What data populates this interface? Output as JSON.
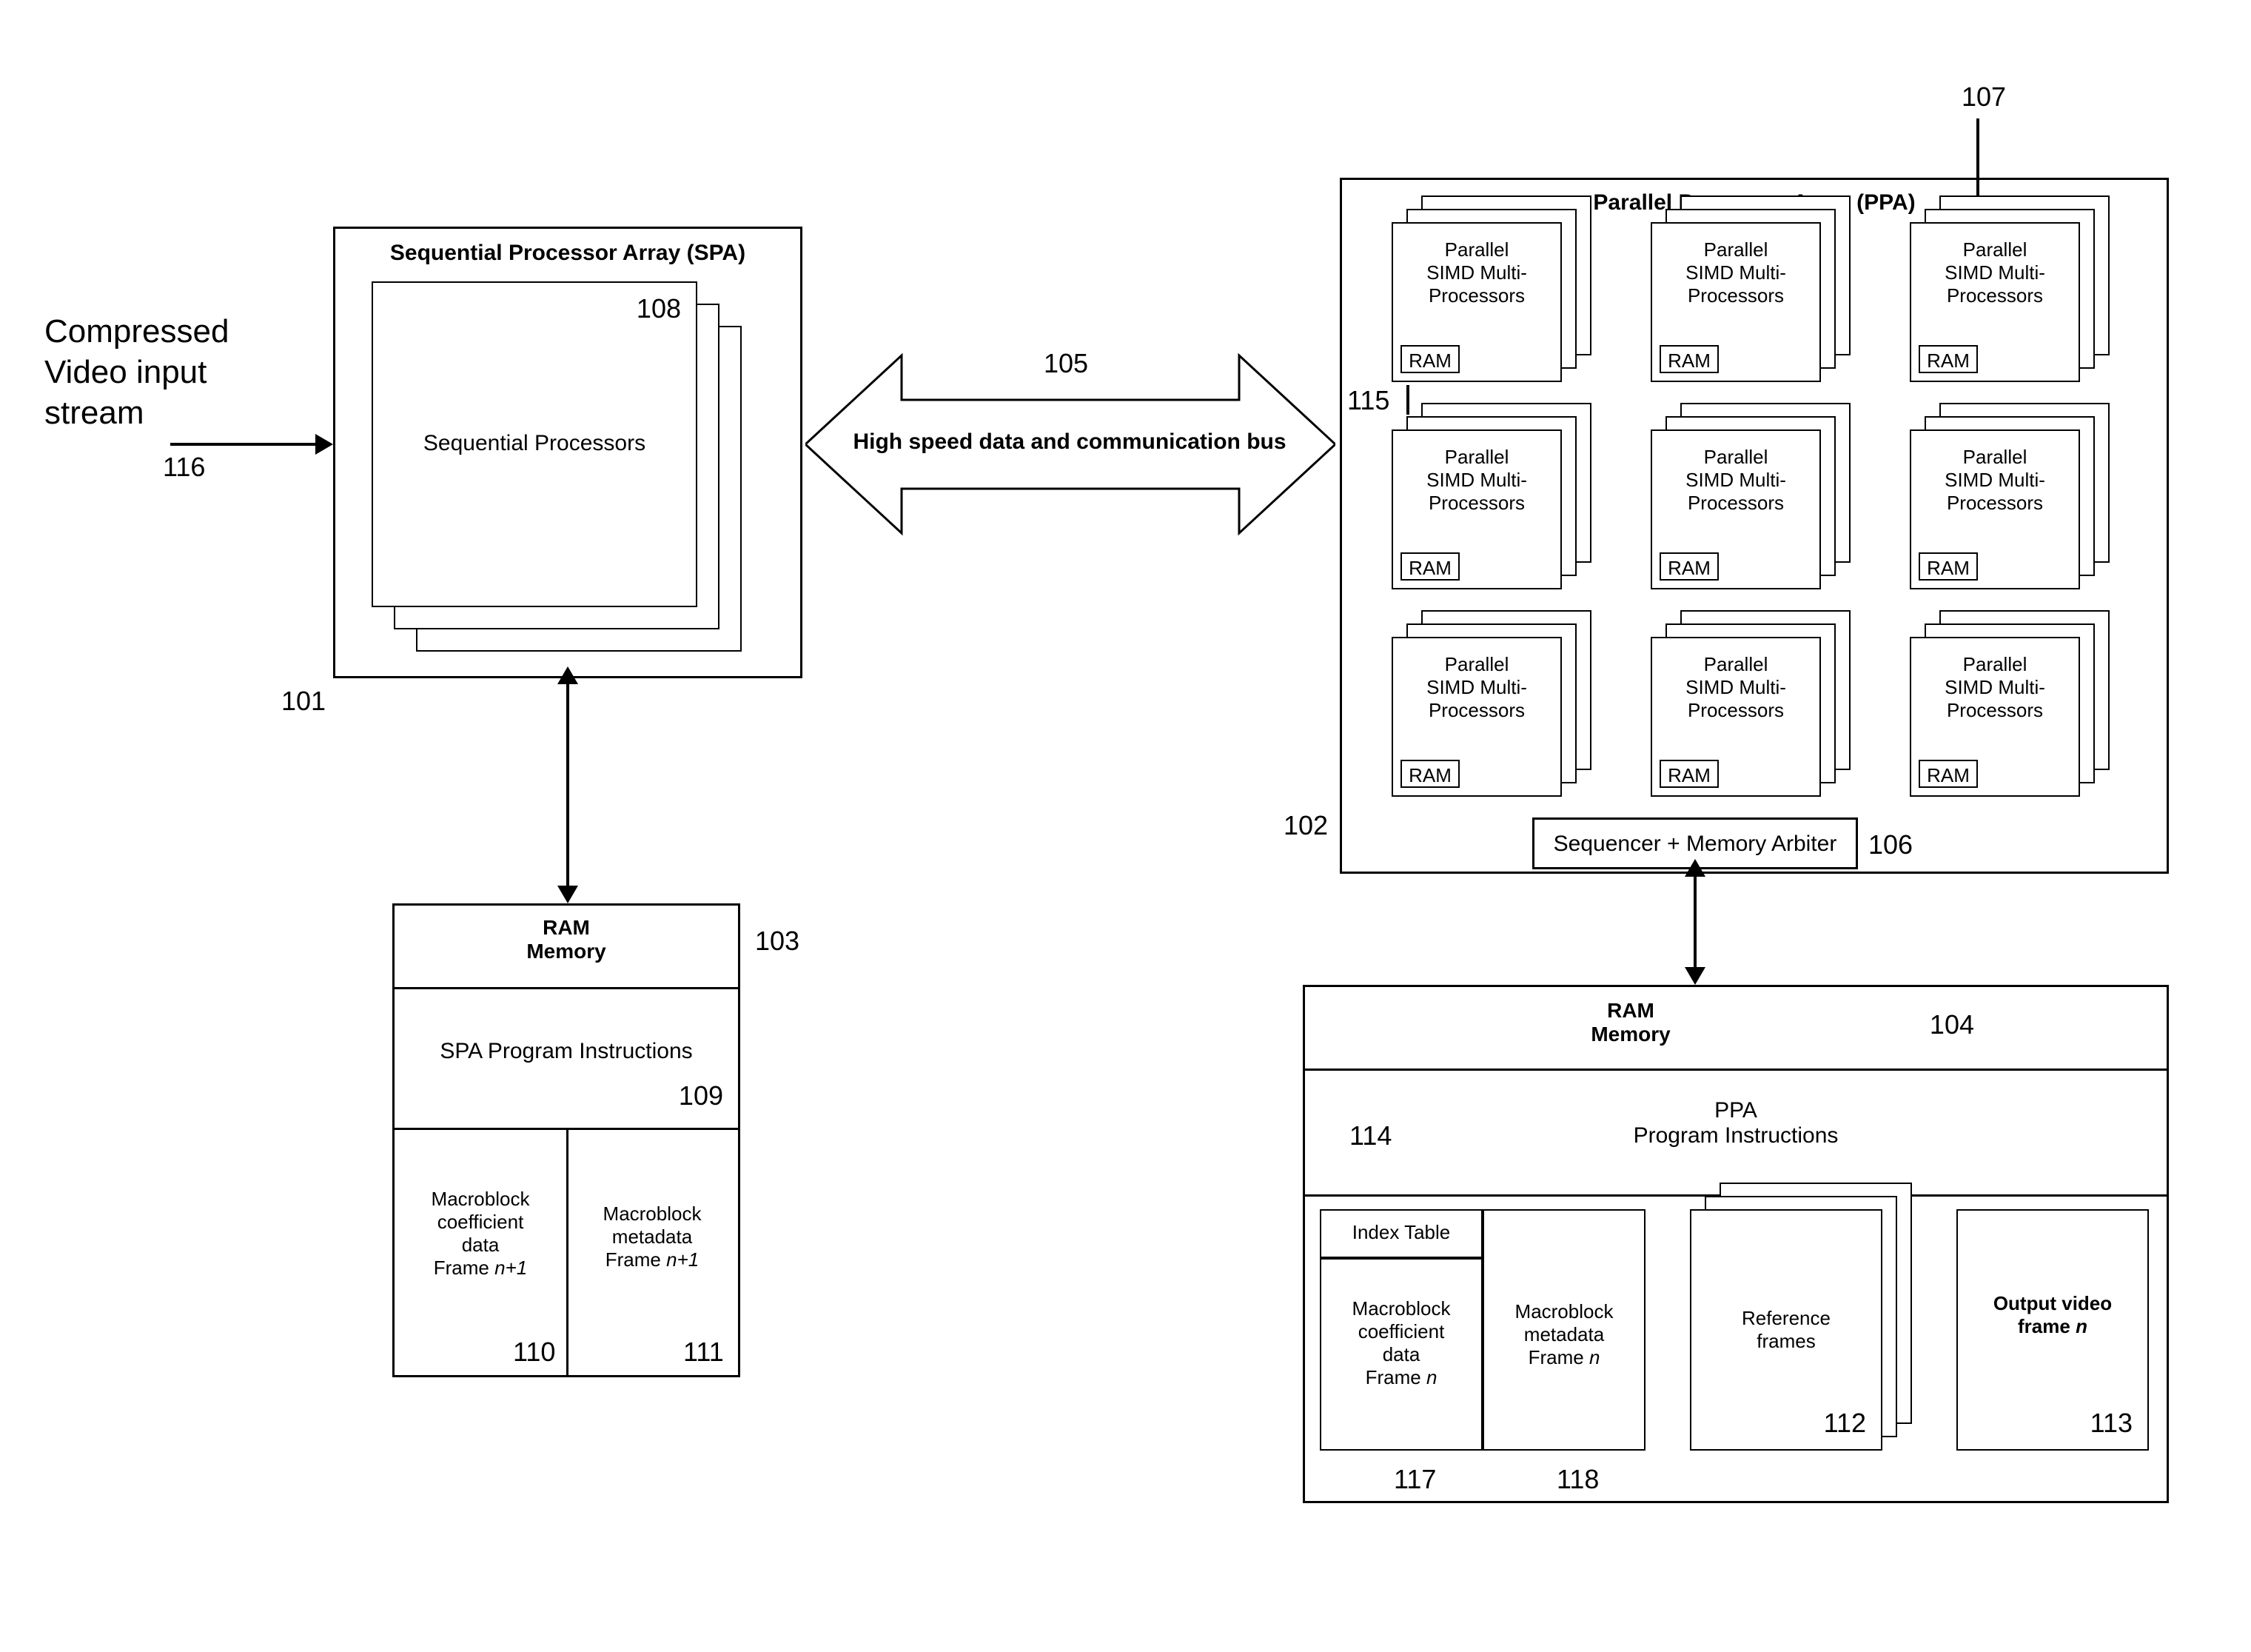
{
  "input": {
    "label": "Compressed\nVideo input\nstream",
    "ref": "116"
  },
  "spa": {
    "title": "Sequential Processor Array (SPA)",
    "ref": "101",
    "proc": {
      "label": "Sequential Processors",
      "ref": "108"
    }
  },
  "bus": {
    "label": "High speed data and communication bus",
    "ref": "105"
  },
  "ppa": {
    "title": "Parallel Processor Array (PPA)",
    "ref": "102",
    "refTop": "107",
    "refLeft": "115",
    "node": {
      "label": "Parallel\nSIMD Multi-\nProcessors",
      "ram": "RAM"
    },
    "seq": {
      "label": "Sequencer + Memory Arbiter",
      "ref": "106"
    }
  },
  "ramLeft": {
    "title": "RAM\nMemory",
    "ref": "103",
    "prog": {
      "label": "SPA Program Instructions",
      "ref": "109"
    },
    "coef": {
      "label": "Macroblock\ncoefficient\ndata\nFrame",
      "suffix": "n+1",
      "ref": "110"
    },
    "meta": {
      "label": "Macroblock\nmetadata\nFrame",
      "suffix": "n+1",
      "ref": "111"
    }
  },
  "ramRight": {
    "title": "RAM\nMemory",
    "ref": "104",
    "prog": {
      "label": "PPA\nProgram Instructions",
      "ref": "114"
    },
    "idx": {
      "label": "Index Table"
    },
    "coef": {
      "label": "Macroblock\ncoefficient\ndata\nFrame",
      "suffix": "n",
      "ref": "117"
    },
    "meta": {
      "label": "Macroblock\nmetadata\nFrame",
      "suffix": "n",
      "ref": "118"
    },
    "refFrames": {
      "label": "Reference\nframes",
      "ref": "112"
    },
    "output": {
      "label": "Output video\nframe",
      "suffix": "n",
      "ref": "113"
    }
  }
}
